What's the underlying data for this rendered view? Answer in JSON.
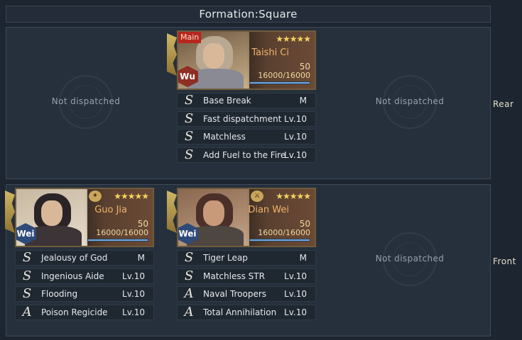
{
  "title": "Formation:Square",
  "rows": {
    "rear_label": "Rear",
    "front_label": "Front"
  },
  "empty_text": "Not dispatched",
  "heroes": {
    "taishi_ci": {
      "name": "Taishi Ci",
      "tag": "Main",
      "faction": "Wu",
      "faction_color": "#8e2e24",
      "stars": "★★★★★",
      "level": "50",
      "troops": "16000/16000",
      "troop_fraction": 1.0,
      "skills": [
        {
          "grade": "S",
          "name": "Base Break",
          "lv": "M"
        },
        {
          "grade": "S",
          "name": "Fast dispatchment",
          "lv": "Lv.10"
        },
        {
          "grade": "S",
          "name": "Matchless",
          "lv": "Lv.10"
        },
        {
          "grade": "S",
          "name": "Add Fuel to the Fire",
          "lv": "Lv.10"
        }
      ]
    },
    "guo_jia": {
      "name": "Guo Jia",
      "faction": "Wei",
      "faction_color": "#2e4a78",
      "stars": "★★★★★",
      "level": "50",
      "troops": "16000/16000",
      "troop_fraction": 1.0,
      "skills": [
        {
          "grade": "S",
          "name": "Jealousy of God",
          "lv": "M"
        },
        {
          "grade": "S",
          "name": "Ingenious Aide",
          "lv": "Lv.10"
        },
        {
          "grade": "S",
          "name": "Flooding",
          "lv": "Lv.10"
        },
        {
          "grade": "A",
          "name": "Poison Regicide",
          "lv": "Lv.10"
        }
      ]
    },
    "dian_wei": {
      "name": "Dian Wei",
      "faction": "Wei",
      "faction_color": "#2e4a78",
      "stars": "★★★★★",
      "level": "50",
      "troops": "16000/16000",
      "troop_fraction": 1.0,
      "skills": [
        {
          "grade": "S",
          "name": "Tiger Leap",
          "lv": "M"
        },
        {
          "grade": "S",
          "name": "Matchless STR",
          "lv": "Lv.10"
        },
        {
          "grade": "A",
          "name": "Naval Troopers",
          "lv": "Lv.10"
        },
        {
          "grade": "A",
          "name": "Total Annihilation",
          "lv": "Lv.10"
        }
      ]
    }
  },
  "icons": {
    "star": "star-icon",
    "flag": "banner-flag-icon",
    "emblem": "empty-slot-emblem-icon"
  }
}
